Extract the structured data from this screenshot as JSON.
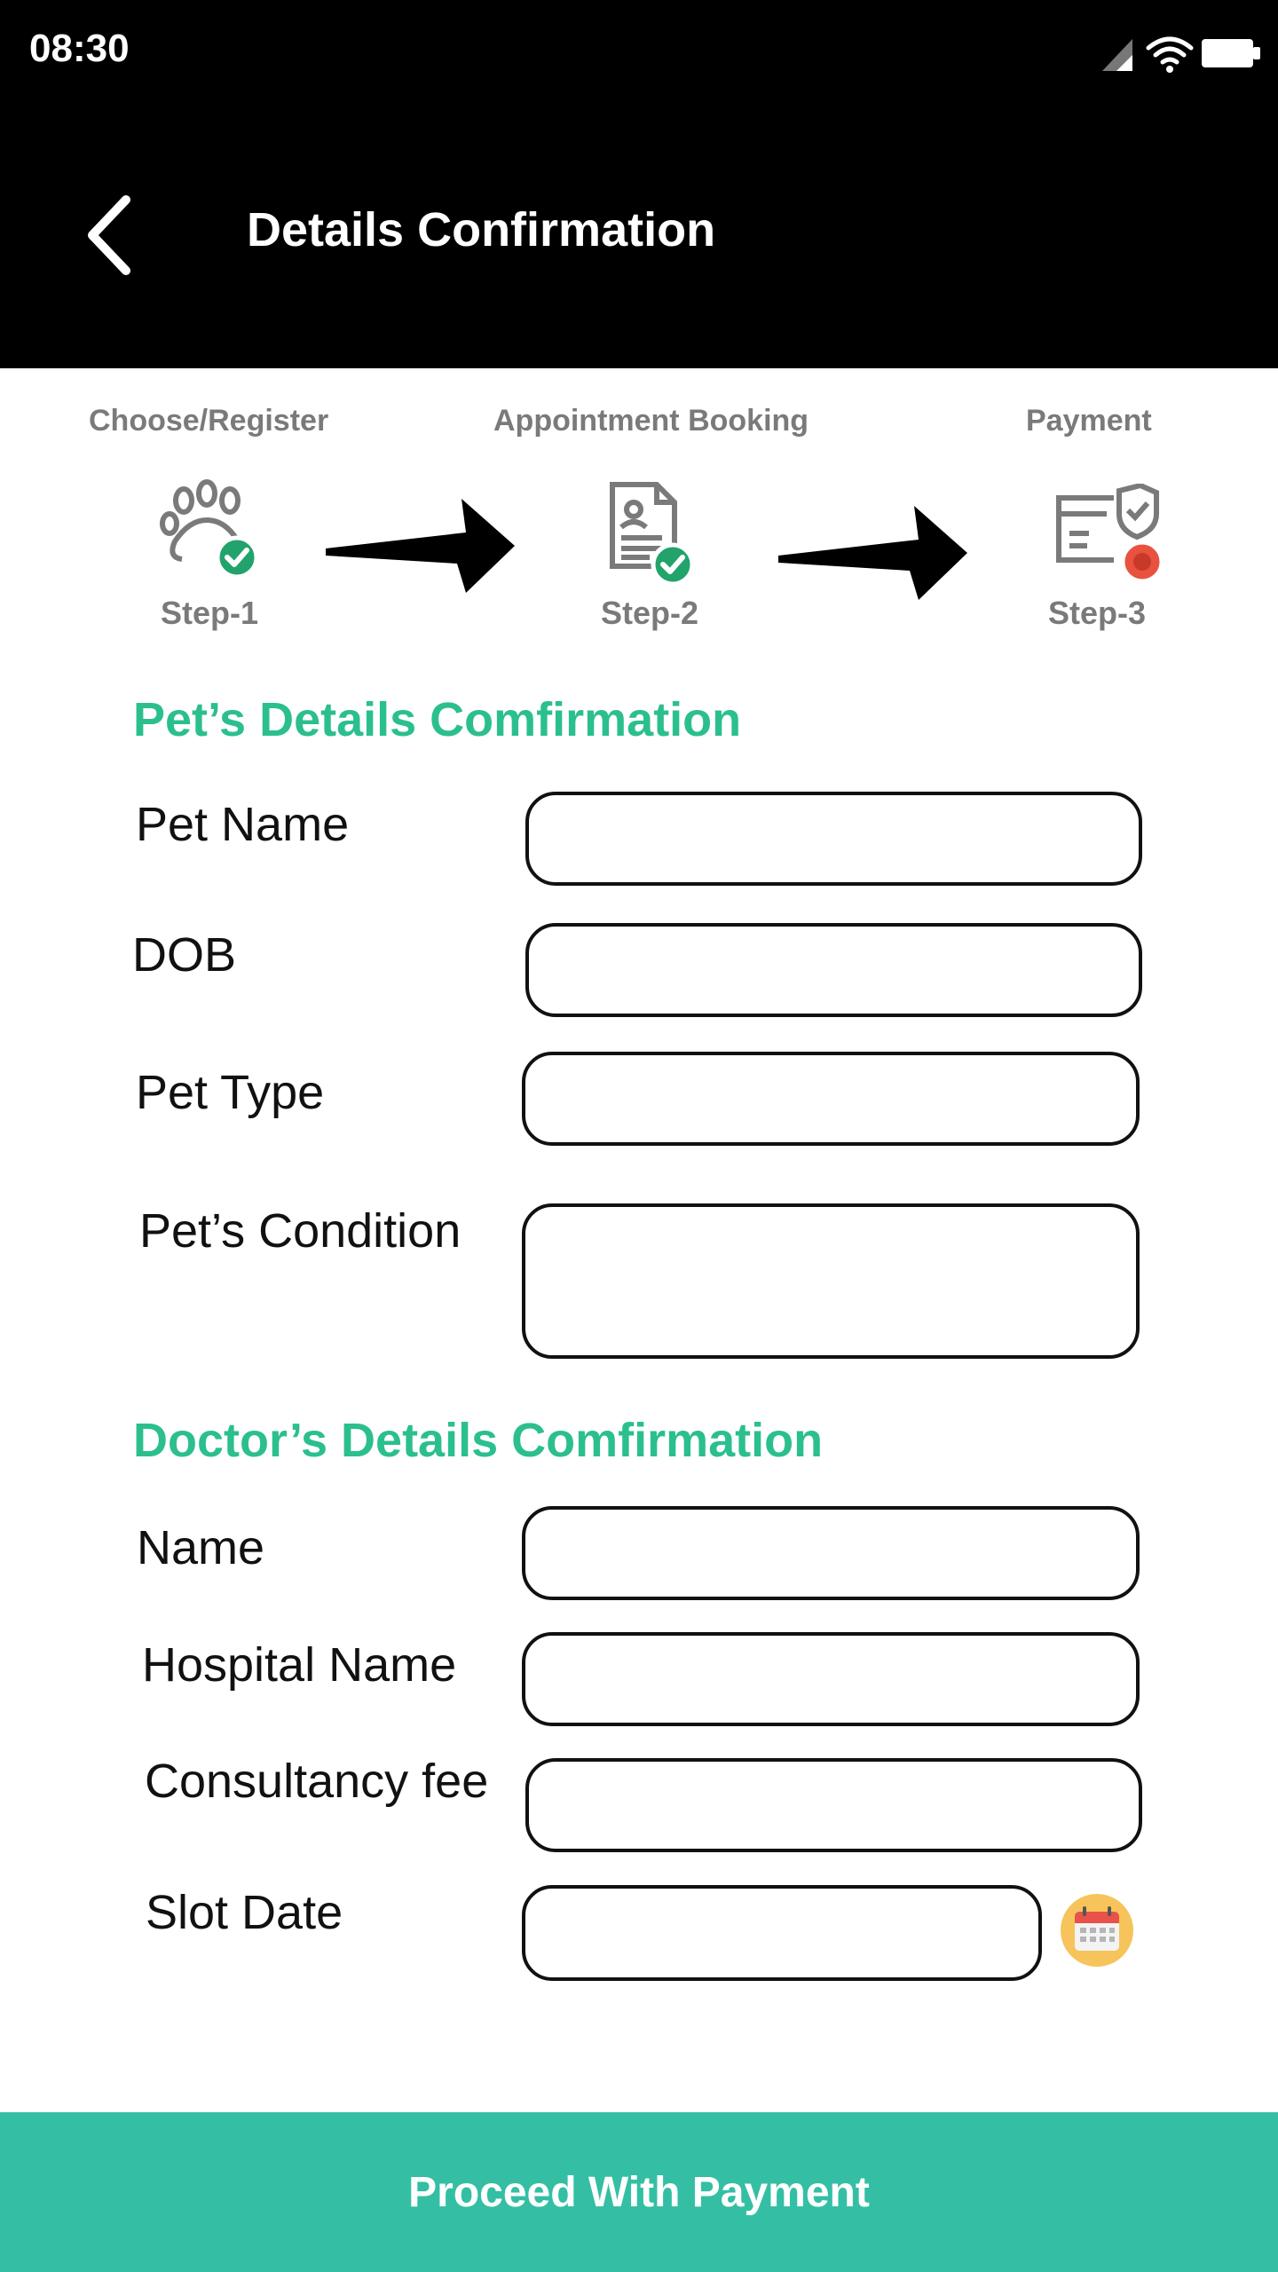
{
  "status_bar": {
    "time": "08:30"
  },
  "header": {
    "title": "Details Confirmation"
  },
  "stepper": {
    "steps": [
      {
        "top_label": "Choose/Register",
        "caption": "Step-1",
        "state": "done"
      },
      {
        "top_label": "Appointment Booking",
        "caption": "Step-2",
        "state": "done"
      },
      {
        "top_label": "Payment",
        "caption": "Step-3",
        "state": "current"
      }
    ]
  },
  "pet_section": {
    "title": "Pet’s Details Comfirmation",
    "fields": [
      {
        "label": "Pet Name",
        "value": ""
      },
      {
        "label": "DOB",
        "value": ""
      },
      {
        "label": "Pet Type",
        "value": ""
      },
      {
        "label": "Pet’s Condition",
        "value": ""
      }
    ]
  },
  "doctor_section": {
    "title": "Doctor’s Details Comfirmation",
    "fields": [
      {
        "label": "Name",
        "value": ""
      },
      {
        "label": "Hospital Name",
        "value": ""
      },
      {
        "label": "Consultancy fee",
        "value": ""
      },
      {
        "label": "Slot Date",
        "value": ""
      }
    ]
  },
  "colors": {
    "accent": "#2bbf8f",
    "button": "#34bfa4",
    "done_badge": "#22a36b",
    "current_badge": "#e8523f",
    "calendar": "#f6c45a"
  },
  "footer": {
    "proceed_label": "Proceed With Payment"
  }
}
